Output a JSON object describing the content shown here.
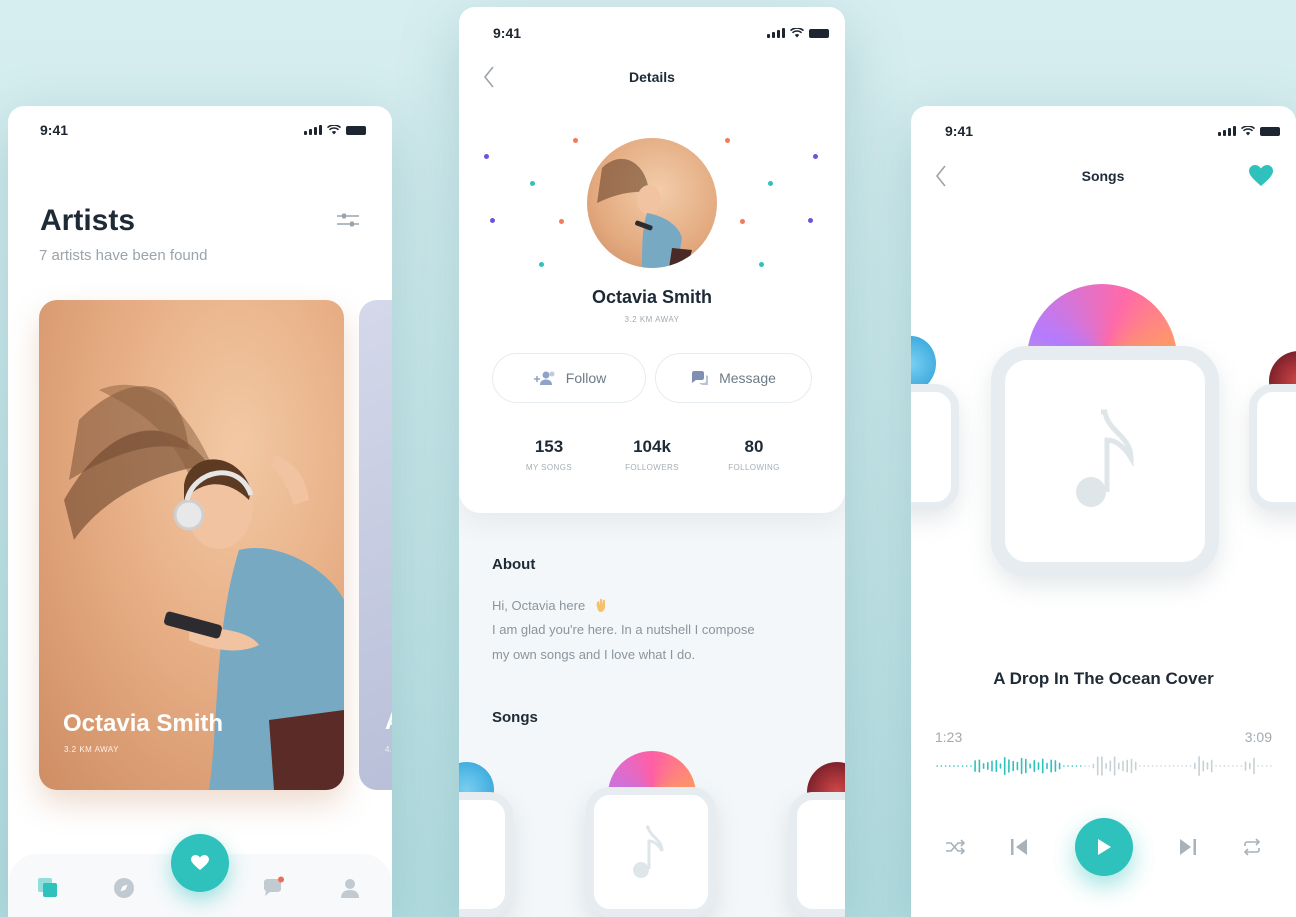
{
  "colors": {
    "accent": "#2fc1bc",
    "text_dark": "#1e2b36",
    "text_muted": "#9aa4ac",
    "confetti": [
      "#6a57d6",
      "#2fc1bc",
      "#f07a5a"
    ]
  },
  "screen_artists": {
    "status_time": "9:41",
    "title": "Artists",
    "subtitle": "7 artists have been found",
    "cards": [
      {
        "name": "Octavia Smith",
        "distance": "3.2 KM AWAY"
      },
      {
        "name": "A",
        "distance": "4."
      }
    ],
    "tabs": [
      "cards-icon",
      "compass-icon",
      "heart-icon",
      "chat-icon",
      "user-icon"
    ]
  },
  "screen_details": {
    "status_time": "9:41",
    "nav_title": "Details",
    "artist_name": "Octavia Smith",
    "distance": "3.2 KM AWAY",
    "follow_label": "Follow",
    "message_label": "Message",
    "stats": [
      {
        "value": "153",
        "label": "MY SONGS"
      },
      {
        "value": "104k",
        "label": "FOLLOWERS"
      },
      {
        "value": "80",
        "label": "FOLLOWING"
      }
    ],
    "about_heading": "About",
    "about_lines": [
      "Hi, Octavia here",
      "I am glad you're here. In a nutshell I compose",
      "my own songs and I love what I do."
    ],
    "songs_heading": "Songs"
  },
  "screen_player": {
    "status_time": "9:41",
    "nav_title": "Songs",
    "song_title": "A Drop In The Ocean Cover",
    "elapsed": "1:23",
    "duration": "3:09",
    "progress": 0.44
  }
}
